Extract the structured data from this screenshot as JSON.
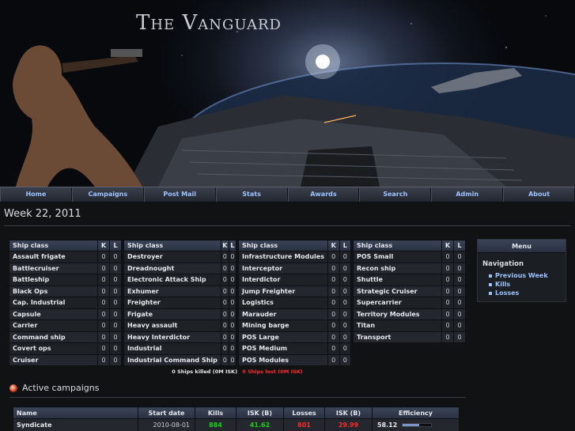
{
  "banner": {
    "title": "The Vanguard"
  },
  "nav": {
    "items": [
      "Home",
      "Campaigns",
      "Post Mail",
      "Stats",
      "Awards",
      "Search",
      "Admin",
      "About"
    ]
  },
  "week": {
    "title": "Week 22, 2011"
  },
  "ship_tables": {
    "headers": {
      "ship_class": "Ship class",
      "k": "K",
      "l": "L"
    },
    "columns": [
      [
        {
          "name": "Assault frigate",
          "k": "0",
          "l": "0"
        },
        {
          "name": "Battlecruiser",
          "k": "0",
          "l": "0"
        },
        {
          "name": "Battleship",
          "k": "0",
          "l": "0"
        },
        {
          "name": "Black Ops",
          "k": "0",
          "l": "0"
        },
        {
          "name": "Cap. Industrial",
          "k": "0",
          "l": "0"
        },
        {
          "name": "Capsule",
          "k": "0",
          "l": "0"
        },
        {
          "name": "Carrier",
          "k": "0",
          "l": "0"
        },
        {
          "name": "Command ship",
          "k": "0",
          "l": "0"
        },
        {
          "name": "Covert ops",
          "k": "0",
          "l": "0"
        },
        {
          "name": "Cruiser",
          "k": "0",
          "l": "0"
        }
      ],
      [
        {
          "name": "Destroyer",
          "k": "0",
          "l": "0"
        },
        {
          "name": "Dreadnought",
          "k": "0",
          "l": "0"
        },
        {
          "name": "Electronic Attack Ship",
          "k": "0",
          "l": "0"
        },
        {
          "name": "Exhumer",
          "k": "0",
          "l": "0"
        },
        {
          "name": "Freighter",
          "k": "0",
          "l": "0"
        },
        {
          "name": "Frigate",
          "k": "0",
          "l": "0"
        },
        {
          "name": "Heavy assault",
          "k": "0",
          "l": "0"
        },
        {
          "name": "Heavy Interdictor",
          "k": "0",
          "l": "0"
        },
        {
          "name": "Industrial",
          "k": "0",
          "l": "0"
        },
        {
          "name": "Industrial Command Ship",
          "k": "0",
          "l": "0"
        }
      ],
      [
        {
          "name": "Infrastructure Modules",
          "k": "0",
          "l": "0"
        },
        {
          "name": "Interceptor",
          "k": "0",
          "l": "0"
        },
        {
          "name": "Interdictor",
          "k": "0",
          "l": "0"
        },
        {
          "name": "Jump Freighter",
          "k": "0",
          "l": "0"
        },
        {
          "name": "Logistics",
          "k": "0",
          "l": "0"
        },
        {
          "name": "Marauder",
          "k": "0",
          "l": "0"
        },
        {
          "name": "Mining barge",
          "k": "0",
          "l": "0"
        },
        {
          "name": "POS Large",
          "k": "0",
          "l": "0"
        },
        {
          "name": "POS Medium",
          "k": "0",
          "l": "0"
        },
        {
          "name": "POS Modules",
          "k": "0",
          "l": "0"
        }
      ],
      [
        {
          "name": "POS Small",
          "k": "0",
          "l": "0"
        },
        {
          "name": "Recon ship",
          "k": "0",
          "l": "0"
        },
        {
          "name": "Shuttle",
          "k": "0",
          "l": "0"
        },
        {
          "name": "Strategic Cruiser",
          "k": "0",
          "l": "0"
        },
        {
          "name": "Supercarrier",
          "k": "0",
          "l": "0"
        },
        {
          "name": "Territory Modules",
          "k": "0",
          "l": "0"
        },
        {
          "name": "Titan",
          "k": "0",
          "l": "0"
        },
        {
          "name": "Transport",
          "k": "0",
          "l": "0"
        }
      ]
    ]
  },
  "summary": {
    "killed": "0 Ships killed (0M ISK)",
    "lost": "0 Ships lost (0M ISK)"
  },
  "menu": {
    "title": "Menu",
    "section": "Navigation",
    "links": [
      "Previous Week",
      "Kills",
      "Losses"
    ]
  },
  "campaigns": {
    "title": "Active campaigns",
    "headers": [
      "Name",
      "Start date",
      "Kills",
      "ISK (B)",
      "Losses",
      "ISK (B)",
      "Efficiency"
    ],
    "rows": [
      {
        "name": "Syndicate",
        "start": "2010-08-01",
        "kills": "884",
        "kills_isk": "41.62",
        "losses": "801",
        "losses_isk": "29.99",
        "efficiency": "58.12",
        "efficiency_fraction": 0.58
      }
    ]
  },
  "colors": {
    "link": "#9cc3ff",
    "positive": "#17d317",
    "negative": "#ff2a2a",
    "header_bg": "#2f3749"
  }
}
